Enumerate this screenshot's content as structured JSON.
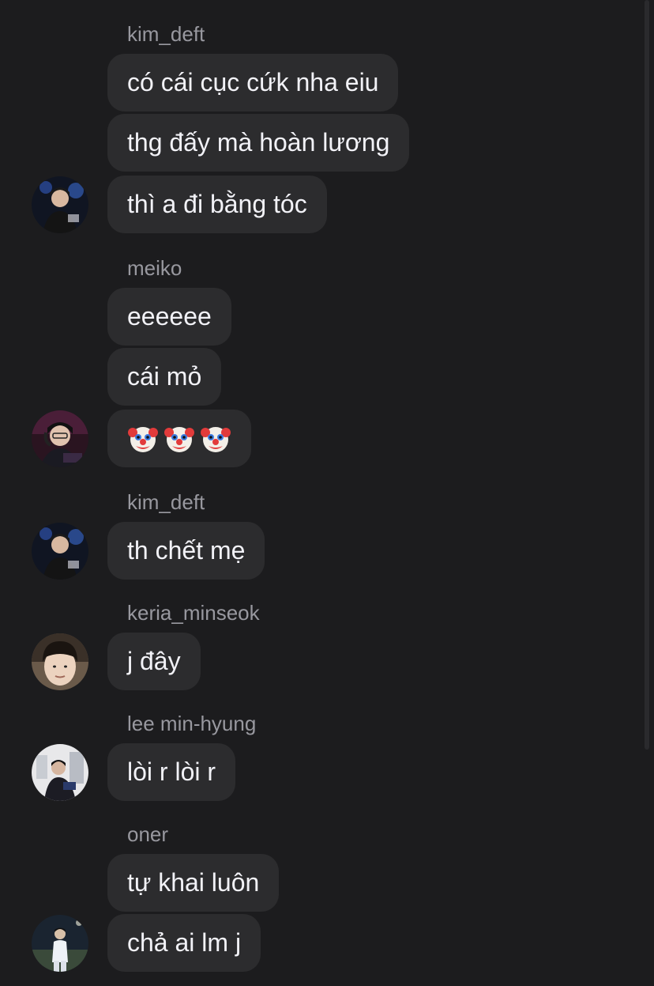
{
  "groups": [
    {
      "sender": "kim_deft",
      "avatar": "kim-deft-avatar",
      "messages": [
        "có cái cục cứk nha eiu",
        "thg đấy mà hoàn lương",
        "thì a đi bằng tóc"
      ]
    },
    {
      "sender": "meiko",
      "avatar": "meiko-avatar",
      "messages": [
        "eeeeee",
        "cái mỏ",
        "🤡🤡🤡"
      ]
    },
    {
      "sender": "kim_deft",
      "avatar": "kim-deft-avatar",
      "messages": [
        "th chết mẹ"
      ]
    },
    {
      "sender": "keria_minseok",
      "avatar": "keria-minseok-avatar",
      "messages": [
        "j đây"
      ]
    },
    {
      "sender": "lee min-hyung",
      "avatar": "lee-min-hyung-avatar",
      "messages": [
        "lòi r lòi r"
      ]
    },
    {
      "sender": "oner",
      "avatar": "oner-avatar",
      "messages": [
        "tự khai luôn",
        "chả ai lm j"
      ]
    }
  ],
  "emoji": {
    "clown_icon": "clown-face-emoji"
  }
}
